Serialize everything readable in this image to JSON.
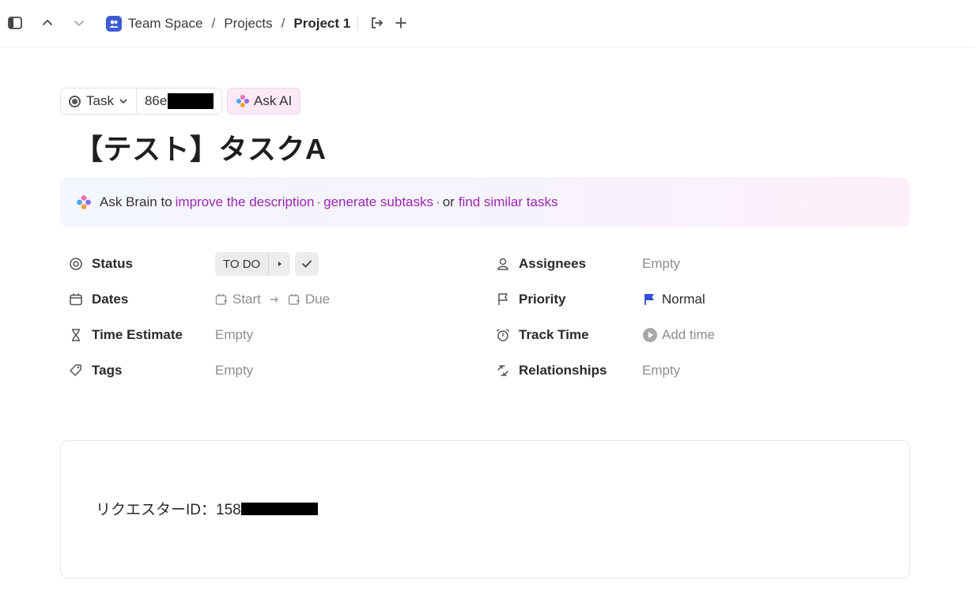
{
  "breadcrumb": {
    "space": "Team Space",
    "projects": "Projects",
    "current": "Project 1",
    "separator": "/"
  },
  "task": {
    "type": "Task",
    "id_prefix": "86e",
    "ask_ai": "Ask AI",
    "title": "【テスト】タスクA"
  },
  "brain": {
    "prefix": "Ask Brain to",
    "link1": "improve the description",
    "dot": "·",
    "link2": "generate subtasks",
    "or": "or",
    "link3": "find similar tasks"
  },
  "fields": {
    "status": {
      "label": "Status",
      "value": "TO DO"
    },
    "dates": {
      "label": "Dates",
      "start": "Start",
      "due": "Due"
    },
    "time_estimate": {
      "label": "Time Estimate",
      "value": "Empty"
    },
    "tags": {
      "label": "Tags",
      "value": "Empty"
    },
    "assignees": {
      "label": "Assignees",
      "value": "Empty"
    },
    "priority": {
      "label": "Priority",
      "value": "Normal"
    },
    "track_time": {
      "label": "Track Time",
      "value": "Add time"
    },
    "relationships": {
      "label": "Relationships",
      "value": "Empty"
    }
  },
  "description": {
    "text_prefix": "リクエスターID：158"
  },
  "colors": {
    "accent_link": "#9b27b0",
    "space_badge": "#3f5bd6",
    "priority_flag": "#2f4fd8"
  },
  "icons": {
    "sidebar": "sidebar-toggle-icon",
    "up": "chevron-up-icon",
    "down": "chevron-down-icon",
    "share": "share-icon",
    "add": "plus-icon",
    "brain": "brain-sparkle-icon"
  }
}
